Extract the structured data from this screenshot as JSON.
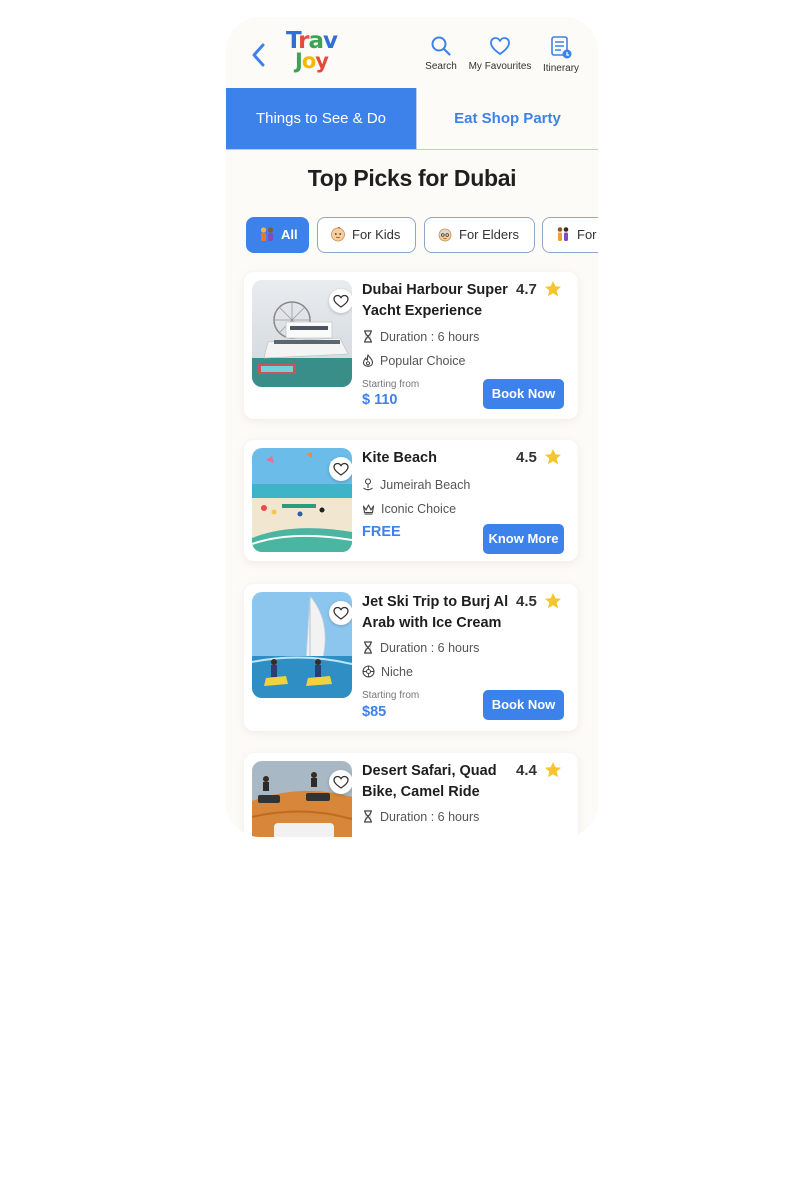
{
  "brand": {
    "line1": [
      "T",
      "r",
      "a",
      "v"
    ],
    "line2": [
      "J",
      "o",
      "y"
    ]
  },
  "header": {
    "nav": [
      {
        "label": "Search",
        "icon": "search-icon"
      },
      {
        "label": "My Favourites",
        "icon": "heart-icon"
      },
      {
        "label": "Itinerary",
        "icon": "itinerary-icon"
      }
    ]
  },
  "tabs": [
    {
      "label": "Things to See & Do",
      "active": true
    },
    {
      "label": "Eat Shop Party",
      "active": false
    }
  ],
  "heading": "Top Picks for Dubai",
  "filters": [
    {
      "label": "All",
      "active": true
    },
    {
      "label": "For Kids",
      "active": false
    },
    {
      "label": "For Elders",
      "active": false
    },
    {
      "label": "For",
      "active": false
    }
  ],
  "cards": [
    {
      "title": "Dubai Harbour Super Yacht Experience",
      "rating": "4.7",
      "meta": [
        "Duration : 6 hours",
        "Popular Choice"
      ],
      "price_prefix": "Starting from",
      "price": "$ 110",
      "cta": "Book Now"
    },
    {
      "title": "Kite Beach",
      "rating": "4.5",
      "meta": [
        "Jumeirah Beach",
        "Iconic Choice"
      ],
      "price": "FREE",
      "cta": "Know More"
    },
    {
      "title": "Jet Ski Trip to Burj Al Arab with Ice Cream",
      "rating": "4.5",
      "meta": [
        "Duration : 6 hours",
        "Niche"
      ],
      "price_prefix": "Starting from",
      "price": "$85",
      "cta": "Book Now"
    },
    {
      "title": "Desert Safari, Quad Bike, Camel Ride",
      "rating": "4.4",
      "meta": [
        "Duration : 6 hours"
      ]
    }
  ],
  "colors": {
    "accent": "#3d82ea",
    "star": "#f7c52b",
    "background": "#fdfbf8"
  }
}
